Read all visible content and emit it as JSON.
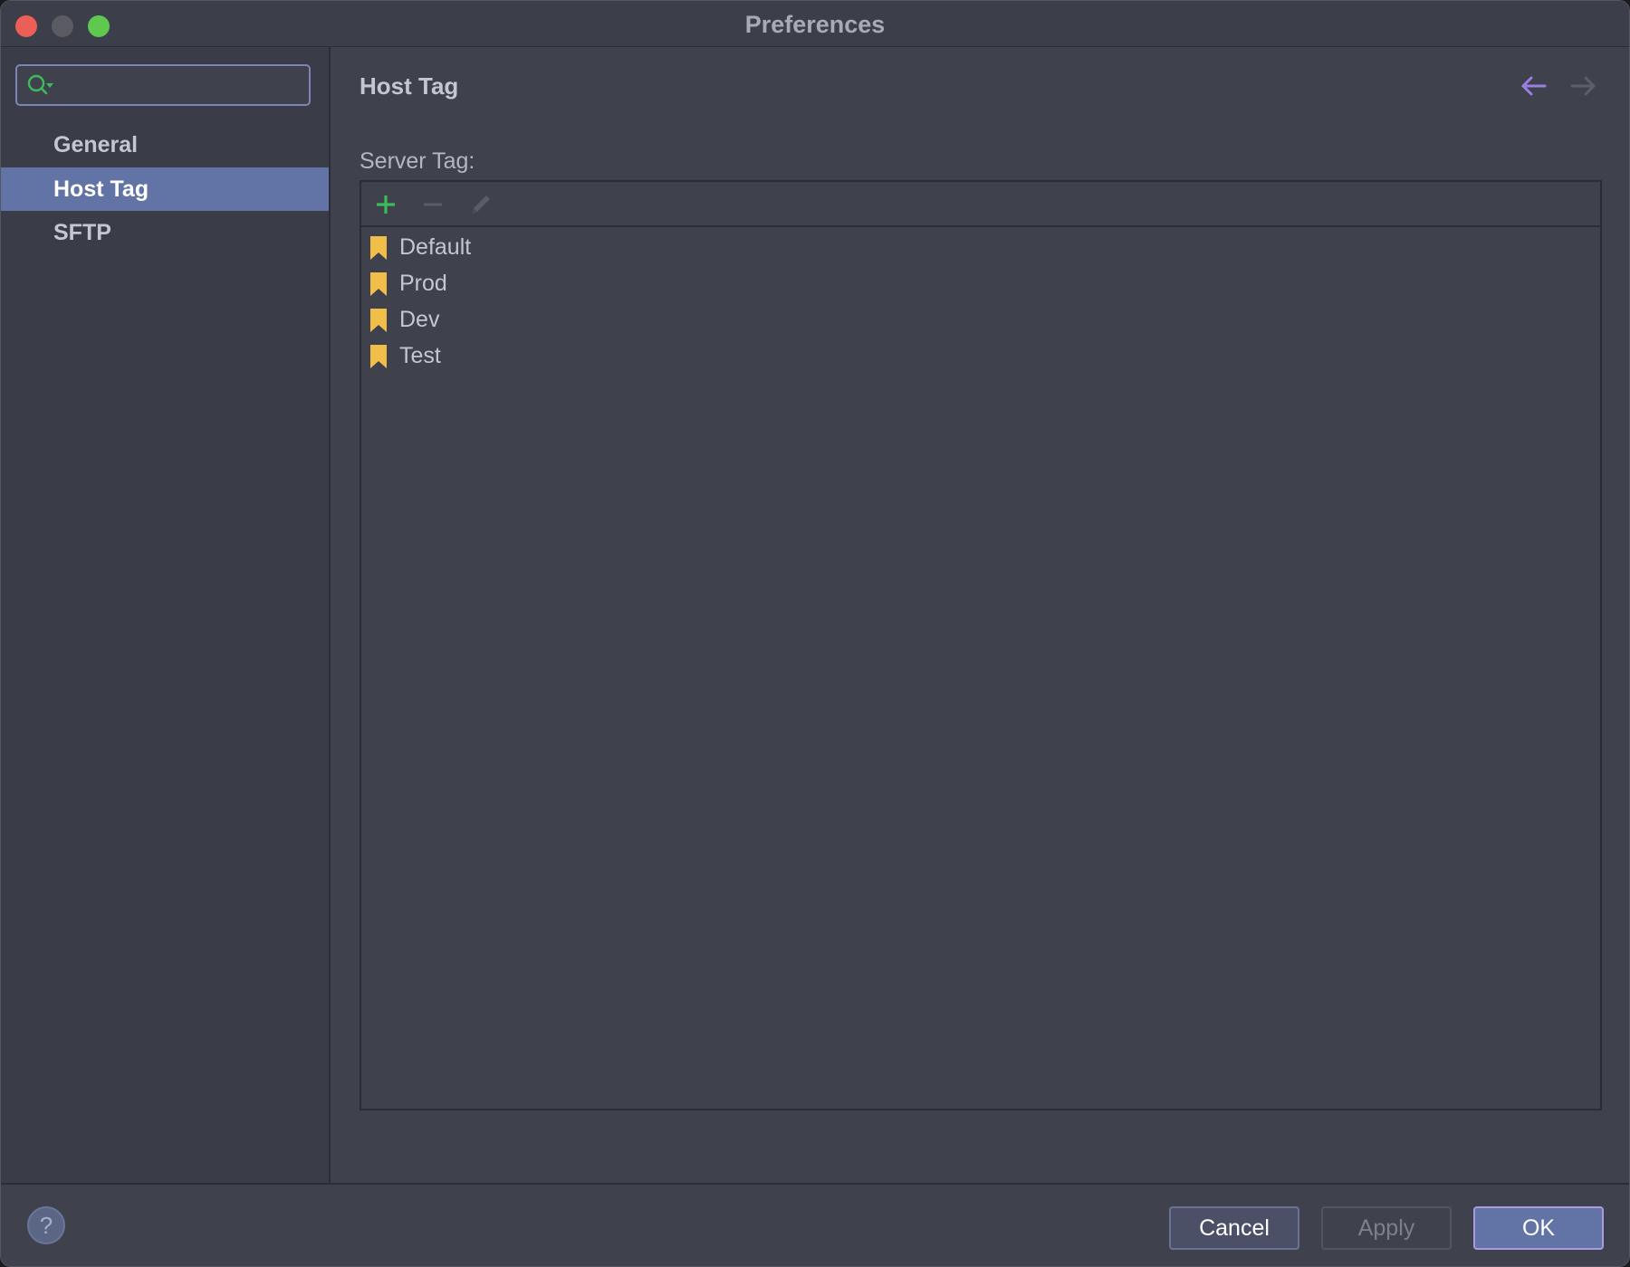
{
  "window": {
    "title": "Preferences"
  },
  "sidebar": {
    "search": {
      "value": "",
      "placeholder": ""
    },
    "items": [
      {
        "label": "General",
        "selected": false
      },
      {
        "label": "Host Tag",
        "selected": true
      },
      {
        "label": "SFTP",
        "selected": false
      }
    ]
  },
  "main": {
    "title": "Host Tag",
    "section_label": "Server Tag:",
    "toolbar": {
      "add_icon": "plus-icon",
      "remove_icon": "minus-icon",
      "edit_icon": "pencil-icon"
    },
    "tags": [
      {
        "label": "Default",
        "icon": "bookmark-icon"
      },
      {
        "label": "Prod",
        "icon": "bookmark-icon"
      },
      {
        "label": "Dev",
        "icon": "bookmark-icon"
      },
      {
        "label": "Test",
        "icon": "bookmark-icon"
      }
    ]
  },
  "footer": {
    "help_label": "?",
    "cancel_label": "Cancel",
    "apply_label": "Apply",
    "ok_label": "OK"
  },
  "colors": {
    "accent": "#6273a6",
    "add_green": "#3dbb5b",
    "tag_yellow": "#f2be4a",
    "nav_back_purple": "#9b7fe3",
    "close_red": "#ec5f58",
    "zoom_green": "#5ec84f"
  }
}
